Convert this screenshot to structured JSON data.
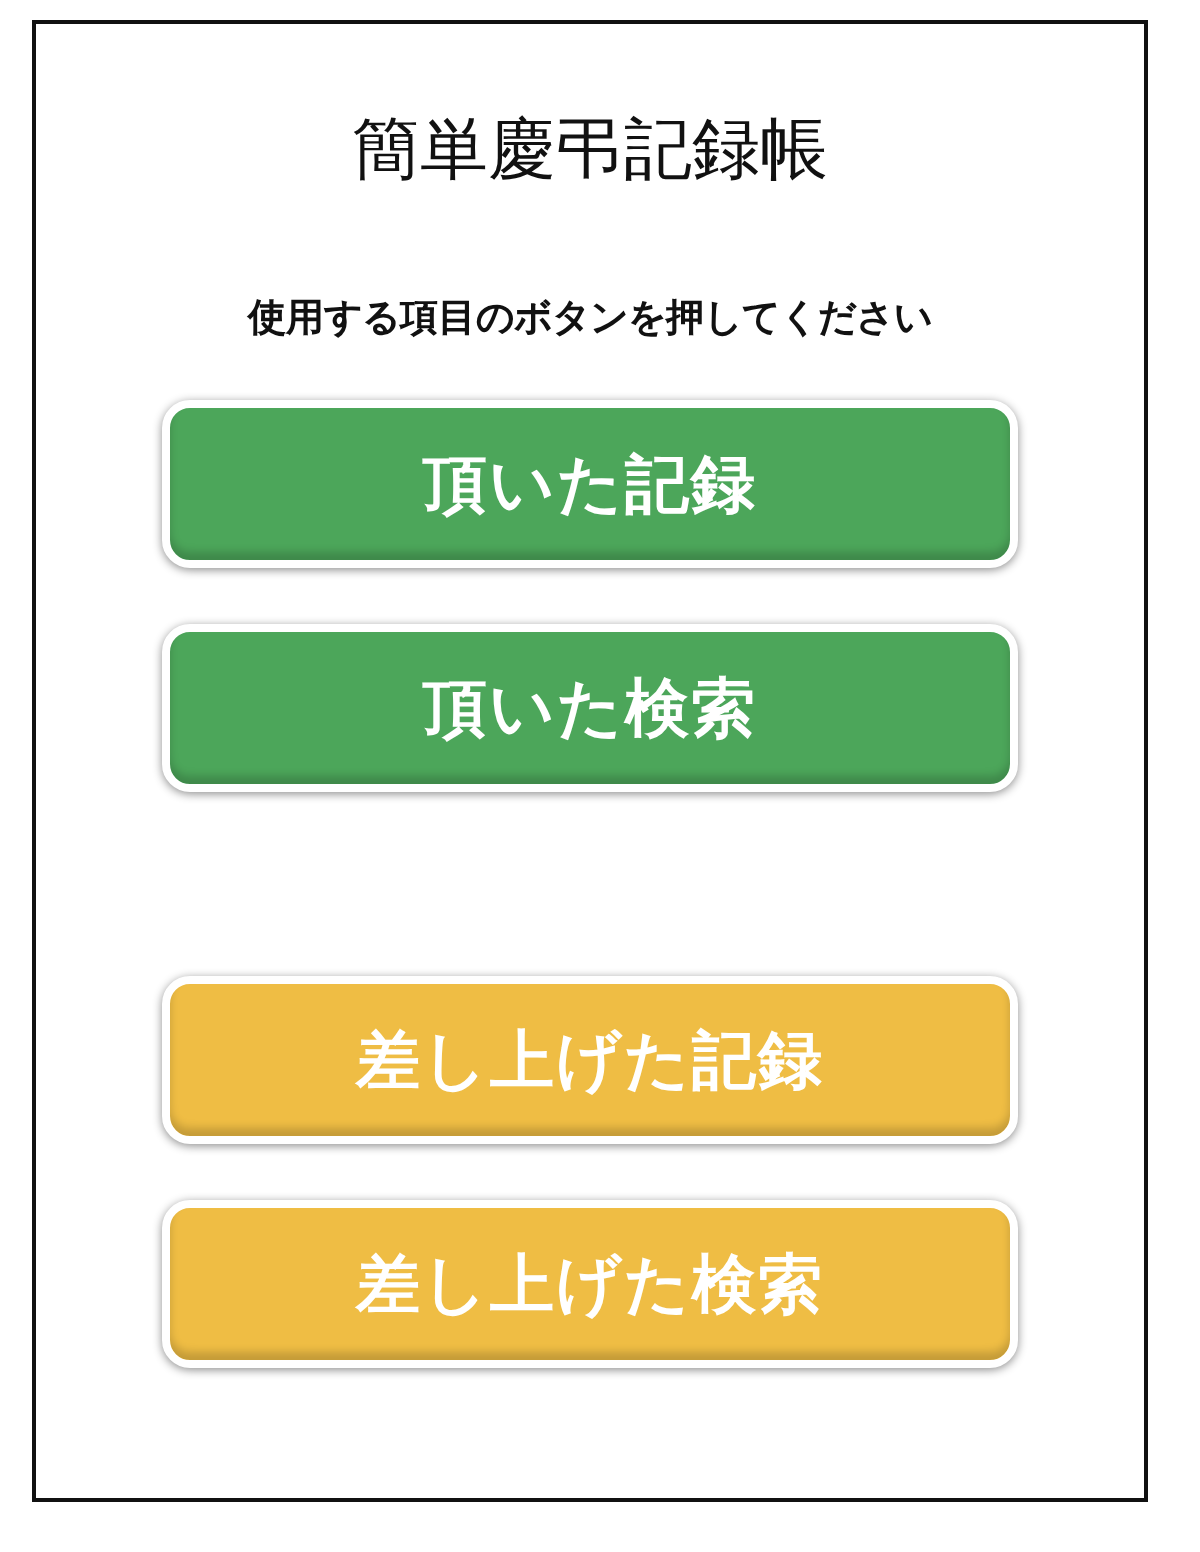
{
  "title": "簡単慶弔記録帳",
  "instruction": "使用する項目のボタンを押してください",
  "button_groups": [
    {
      "buttons": [
        {
          "label": "頂いた記録",
          "color": "#4ca65a"
        },
        {
          "label": "頂いた検索",
          "color": "#4ca65a"
        }
      ]
    },
    {
      "buttons": [
        {
          "label": "差し上げた記録",
          "color": "#efbd44"
        },
        {
          "label": "差し上げた検索",
          "color": "#efbd44"
        }
      ]
    }
  ]
}
